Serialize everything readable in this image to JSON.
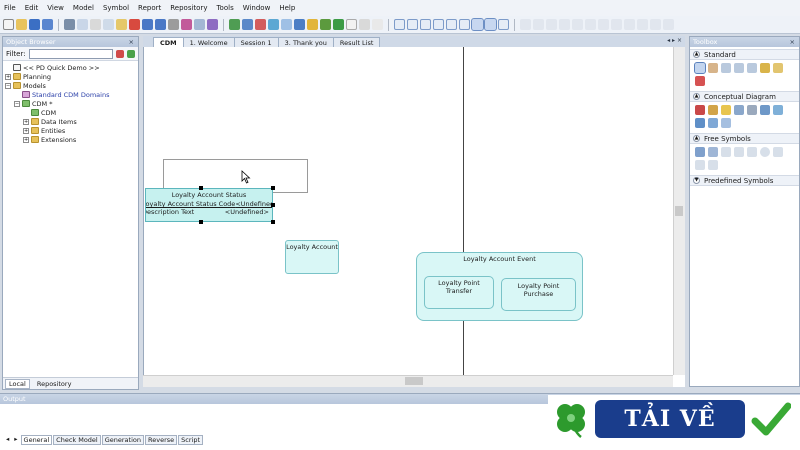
{
  "menu": [
    "File",
    "Edit",
    "View",
    "Model",
    "Symbol",
    "Report",
    "Repository",
    "Tools",
    "Window",
    "Help"
  ],
  "browser": {
    "title": "Object Browser",
    "close": "×",
    "filter_label": "Filter:",
    "tree": [
      {
        "level": 0,
        "expander": "",
        "icon": "root",
        "label": "<< PD Quick Demo >>"
      },
      {
        "level": 0,
        "expander": "+",
        "icon": "folder",
        "label": "Planning"
      },
      {
        "level": 0,
        "expander": "−",
        "icon": "folder",
        "label": "Models"
      },
      {
        "level": 1,
        "expander": "",
        "icon": "domain",
        "label": "Standard CDM Domains"
      },
      {
        "level": 1,
        "expander": "−",
        "icon": "model",
        "label": "CDM *"
      },
      {
        "level": 2,
        "expander": "",
        "icon": "model",
        "label": "CDM"
      },
      {
        "level": 2,
        "expander": "+",
        "icon": "folder",
        "label": "Data Items"
      },
      {
        "level": 2,
        "expander": "+",
        "icon": "folder",
        "label": "Entities"
      },
      {
        "level": 2,
        "expander": "+",
        "icon": "folder",
        "label": "Extensions"
      }
    ],
    "tabs": [
      "Local",
      "Repository"
    ]
  },
  "doctabs": [
    "CDM",
    "1. Welcome",
    "Session 1",
    "3. Thank you",
    "Result List"
  ],
  "doctab_controls": "◂ ▸ ×",
  "diagram": {
    "loyalty_account_status": {
      "title": "Loyalty Account Status",
      "attributes": [
        {
          "name": "Loyalty Account Status Code",
          "type": "<Undefined>",
          "pk": true
        },
        {
          "name": "Description Text",
          "type": "<Undefined>",
          "pk": false
        }
      ]
    },
    "loyalty_account": {
      "title": "Loyalty Account"
    },
    "loyalty_account_event": {
      "title": "Loyalty Account Event"
    },
    "loyalty_point_transfer": {
      "title": "Loyalty Point Transfer"
    },
    "loyalty_point_purchase": {
      "title": "Loyalty Point Purchase"
    }
  },
  "toolbox": {
    "title": "Toolbox",
    "sections": [
      "Standard",
      "Conceptual Diagram",
      "Free Symbols",
      "Predefined Symbols"
    ]
  },
  "output": {
    "title": "Output",
    "tabs": [
      "General",
      "Check Model",
      "Generation",
      "Reverse",
      "Script"
    ]
  },
  "logo": {
    "text": "TẢI VỀ"
  },
  "colors": {
    "entity_fill": "#d9f7f6",
    "entity_border": "#7ac3c8",
    "logo_blue": "#1a3d8c",
    "clover_green": "#2d9a2d",
    "check_green": "#39a935"
  }
}
